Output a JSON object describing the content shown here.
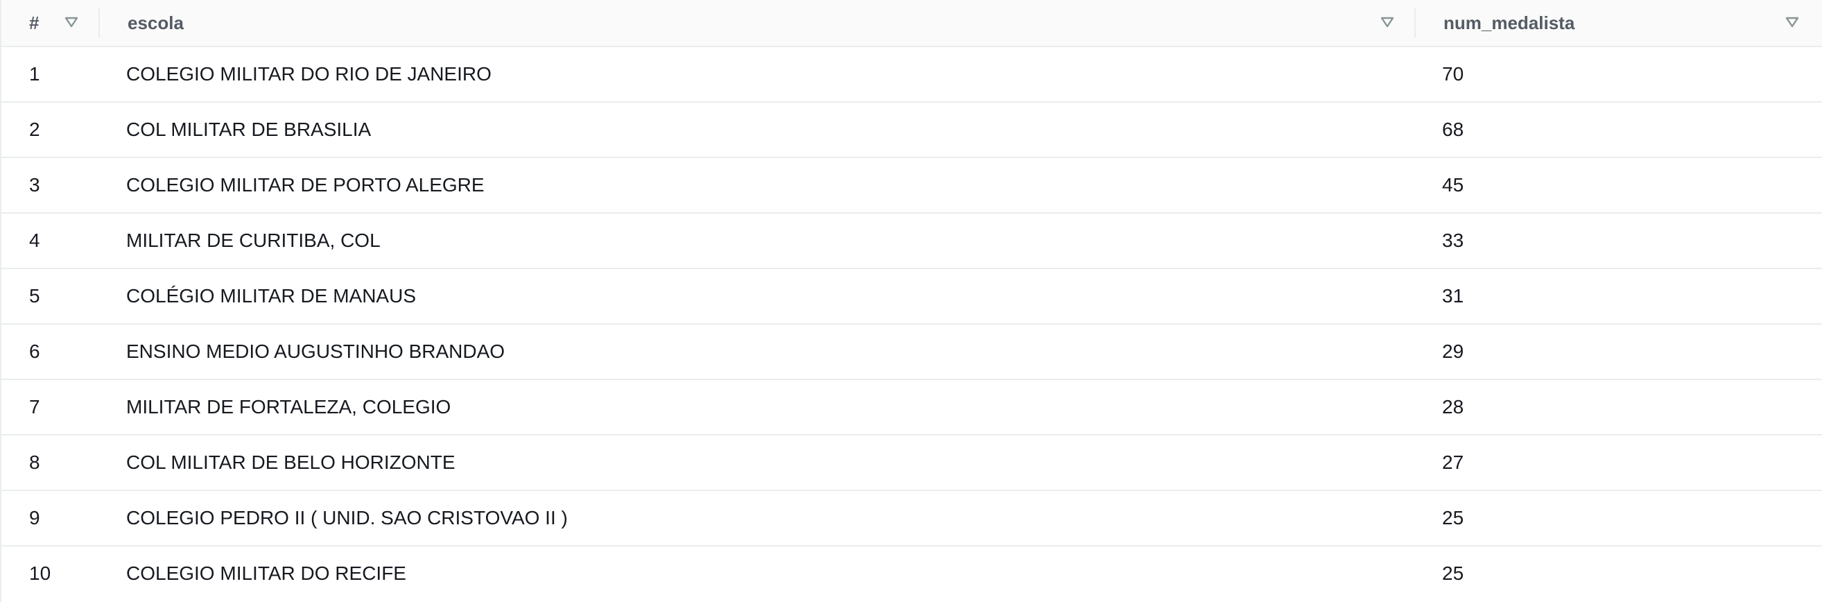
{
  "table": {
    "columns": [
      {
        "key": "index",
        "label": "#"
      },
      {
        "key": "escola",
        "label": "escola"
      },
      {
        "key": "num_medalista",
        "label": "num_medalista"
      }
    ],
    "rows": [
      {
        "index": "1",
        "escola": "COLEGIO MILITAR DO RIO DE JANEIRO",
        "num_medalista": "70"
      },
      {
        "index": "2",
        "escola": "COL MILITAR DE BRASILIA",
        "num_medalista": "68"
      },
      {
        "index": "3",
        "escola": "COLEGIO MILITAR DE PORTO ALEGRE",
        "num_medalista": "45"
      },
      {
        "index": "4",
        "escola": "MILITAR DE CURITIBA, COL",
        "num_medalista": "33"
      },
      {
        "index": "5",
        "escola": "COLÉGIO MILITAR DE MANAUS",
        "num_medalista": "31"
      },
      {
        "index": "6",
        "escola": "ENSINO MEDIO AUGUSTINHO BRANDAO",
        "num_medalista": "29"
      },
      {
        "index": "7",
        "escola": "MILITAR DE FORTALEZA, COLEGIO",
        "num_medalista": "28"
      },
      {
        "index": "8",
        "escola": "COL MILITAR DE BELO HORIZONTE",
        "num_medalista": "27"
      },
      {
        "index": "9",
        "escola": "COLEGIO PEDRO II ( UNID. SAO CRISTOVAO II )",
        "num_medalista": "25"
      },
      {
        "index": "10",
        "escola": "COLEGIO MILITAR DO RECIFE",
        "num_medalista": "25"
      }
    ]
  },
  "icons": {
    "sort": "sort-down-triangle-icon"
  },
  "colors": {
    "header_bg": "#fafafa",
    "header_text": "#545b64",
    "cell_text": "#16191f",
    "border": "#eaeded",
    "icon": "#879596"
  }
}
